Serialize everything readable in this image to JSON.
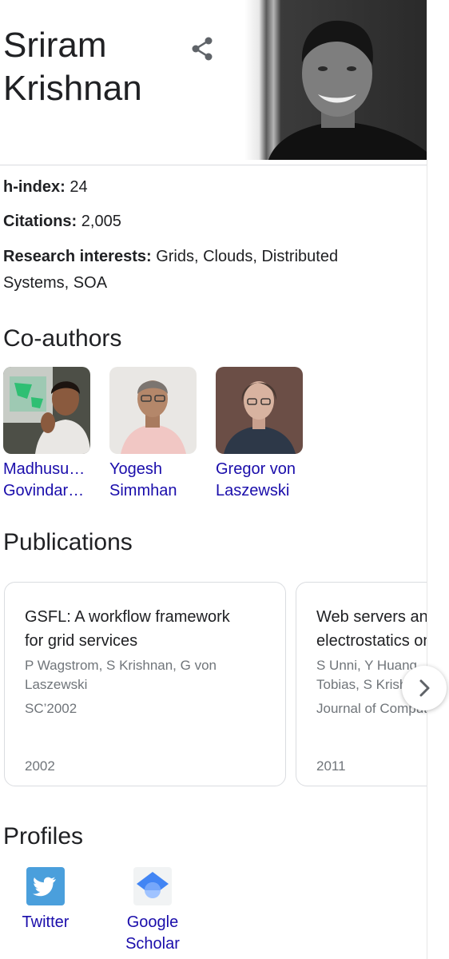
{
  "header": {
    "name": "Sriram\nKrishnan"
  },
  "facts": {
    "hindex_label": "h-index:",
    "hindex_value": " 24",
    "citations_label": "Citations:",
    "citations_value": " 2,005",
    "interests_label": "Research interests:",
    "interests_value": " Grids, Clouds, Distributed Systems, SOA"
  },
  "coauthors": {
    "heading": "Co-authors",
    "items": [
      {
        "label": "Madhusu…\nGovindar…"
      },
      {
        "label": "Yogesh\nSimmhan"
      },
      {
        "label": "Gregor von\nLaszewski"
      }
    ]
  },
  "publications": {
    "heading": "Publications",
    "items": [
      {
        "title": "GSFL: A workflow framework\nfor grid services",
        "authors": "P Wagstrom, S Krishnan, G von\nLaszewski",
        "venue": "SC’2002",
        "year": "2002"
      },
      {
        "title": "Web servers and\nelectrostatics on",
        "authors": "S Unni, Y Huang,\nTobias, S Krishnan",
        "venue": "Journal of Computational",
        "year": "2011"
      }
    ]
  },
  "profiles": {
    "heading": "Profiles",
    "items": [
      {
        "label": "Twitter"
      },
      {
        "label": "Google\nScholar"
      }
    ]
  },
  "icons": {
    "share": "share-icon",
    "next": "chevron-right-icon",
    "twitter": "twitter-icon",
    "scholar": "google-scholar-icon"
  }
}
